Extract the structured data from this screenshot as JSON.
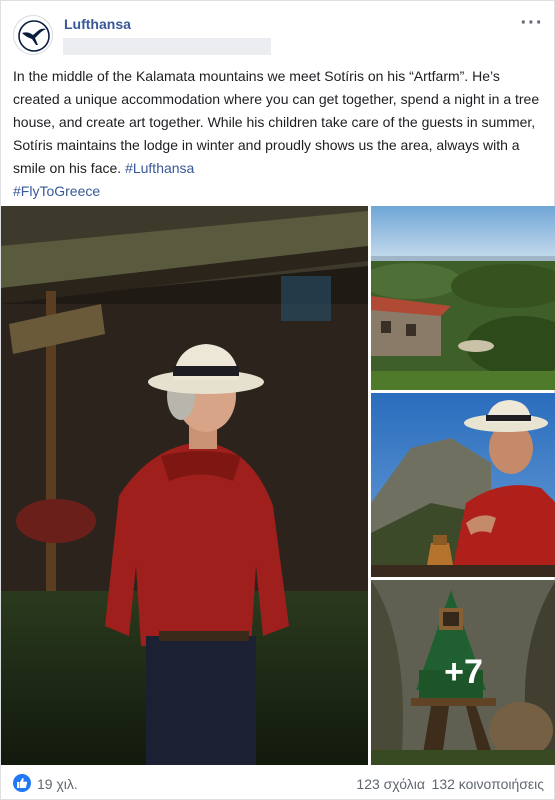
{
  "post": {
    "page_name": "Lufthansa",
    "avatar_icon": "lufthansa-crane-logo",
    "more_icon": "more-dots-icon",
    "text_main": "In the middle of the Kalamata mountains we meet Sotíris on his “Artfarm”. He’s created a unique accommodation where you can get together, spend a night in a tree house, and create art together. While his children take care of the guests in summer, Sotíris maintains the lodge in winter and proudly shows us the area, always with a smile on his face. ",
    "hashtags": [
      "#Lufthansa",
      "#FlyToGreece"
    ]
  },
  "photos": {
    "more_count": "+7",
    "items": [
      {
        "subject": "man-in-red-shirt-and-hat"
      },
      {
        "subject": "mountain-village-view"
      },
      {
        "subject": "man-pouring-coffee"
      },
      {
        "subject": "green-tree-house"
      }
    ]
  },
  "footer": {
    "reactions": "19 χιλ.",
    "comments": "123 σχόλια",
    "shares": "132 κοινοποιήσεις"
  },
  "colors": {
    "link": "#385898",
    "like_blue": "#2078f4",
    "meta_gray": "#606770"
  }
}
